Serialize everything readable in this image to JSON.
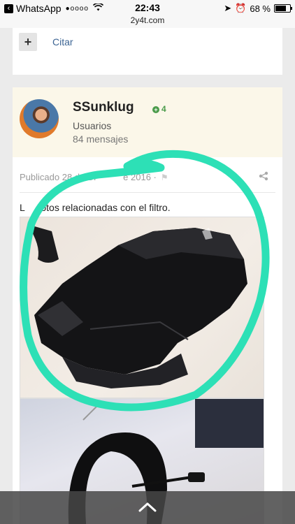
{
  "status_bar": {
    "back_app": "WhatsApp",
    "signal": "●oooo",
    "time": "22:43",
    "url": "2y4t.com",
    "battery_percent": "68 %",
    "icons": [
      "back-icon",
      "wifi-icon",
      "location-arrow-icon",
      "alarm-icon",
      "battery-icon"
    ]
  },
  "prev_post": {
    "plus_label": "+",
    "quote_label": "Citar"
  },
  "post": {
    "author": {
      "name": "SSunklug",
      "reputation": "4",
      "group": "Usuarios",
      "post_count": "84 mensajes"
    },
    "meta": {
      "published": "Publicado 28 de Di",
      "published_tail": "e 2016 ·"
    },
    "body_text_start": "L",
    "body_text_end": "otos relacionadas con el filtro.",
    "icons": [
      "flag-icon",
      "share-icon"
    ]
  },
  "colors": {
    "link": "#3d6594",
    "author_bg": "#fbf7e9",
    "reputation": "#4a9b4a",
    "annotation_ring": "#2de0b6"
  }
}
